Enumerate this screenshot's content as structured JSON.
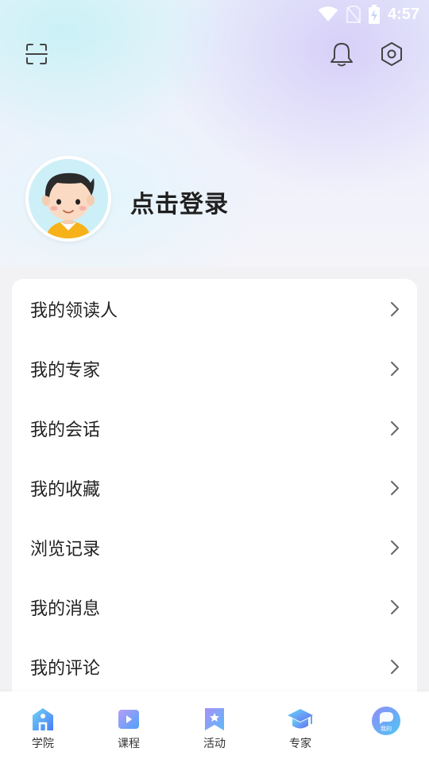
{
  "status_bar": {
    "time": "4:57"
  },
  "header": {
    "scan_icon": "scan-icon",
    "bell_icon": "bell-icon",
    "settings_icon": "settings-icon"
  },
  "profile": {
    "login_label": "点击登录"
  },
  "menu": {
    "items": [
      {
        "label": "我的领读人"
      },
      {
        "label": "我的专家"
      },
      {
        "label": "我的会话"
      },
      {
        "label": "我的收藏"
      },
      {
        "label": "浏览记录"
      },
      {
        "label": "我的消息"
      },
      {
        "label": "我的评论"
      }
    ]
  },
  "tabbar": {
    "tabs": [
      {
        "label": "学院",
        "icon": "academy-icon"
      },
      {
        "label": "课程",
        "icon": "course-icon"
      },
      {
        "label": "活动",
        "icon": "activity-icon"
      },
      {
        "label": "专家",
        "icon": "expert-icon"
      },
      {
        "label": "",
        "badge": "我的",
        "icon": "mine-icon"
      }
    ]
  },
  "colors": {
    "accent_blue": "#4a90f7",
    "accent_cyan": "#5dd6f5",
    "avatar_shirt": "#f7b21a"
  }
}
